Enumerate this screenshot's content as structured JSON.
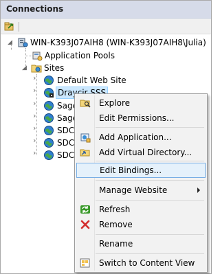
{
  "pane": {
    "title": "Connections"
  },
  "tree": {
    "server": "WIN-K393J07AIH8 (WIN-K393J07AIH8\\Julia)",
    "app_pools": "Application Pools",
    "sites": "Sites",
    "site_items": [
      "Default Web Site",
      "Draycir SSS",
      "Sage",
      "Sage",
      "SDC",
      "SDC",
      "SDC"
    ]
  },
  "context_menu": {
    "explore": "Explore",
    "edit_permissions": "Edit Permissions...",
    "add_application": "Add Application...",
    "add_virtual_directory": "Add Virtual Directory...",
    "edit_bindings": "Edit Bindings...",
    "manage_website": "Manage Website",
    "refresh": "Refresh",
    "remove": "Remove",
    "rename": "Rename",
    "switch_to_content_view": "Switch to Content View"
  },
  "colors": {
    "header_bg": "#d6dbe9",
    "menu_bg": "#f2f2f2",
    "hover_bg": "#e5f1fb",
    "hover_border": "#78aee5",
    "remove_red": "#d32f2f",
    "refresh_green": "#3a9a2b"
  }
}
